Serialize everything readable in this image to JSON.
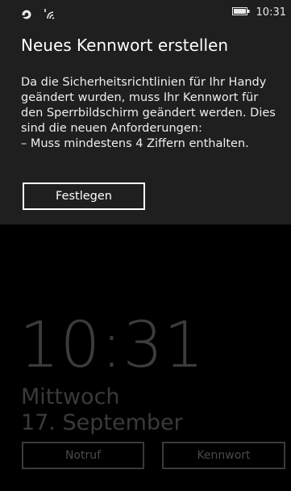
{
  "status_bar": {
    "time": "10:31",
    "icons": [
      "data-sense-icon",
      "signal-icon",
      "battery-icon"
    ]
  },
  "dialog": {
    "title": "Neues Kennwort erstellen",
    "message_lines": [
      "Da die Sicherheitsrichtlinien für Ihr Handy",
      "geändert wurden, muss Ihr Kennwort für",
      "den Sperrbildschirm geändert werden. Dies",
      "sind die neuen Anforderungen:",
      "– Muss mindestens 4 Ziffern enthalten."
    ],
    "set_button_label": "Festlegen"
  },
  "lock_screen": {
    "time": "10:31",
    "weekday": "Mittwoch",
    "date": "17. September",
    "emergency_button_label": "Notruf",
    "password_button_label": "Kennwort"
  },
  "colors": {
    "panel_background": "#1f1f1f",
    "screen_background": "#000000",
    "lock_text": "#3a3a3a"
  }
}
